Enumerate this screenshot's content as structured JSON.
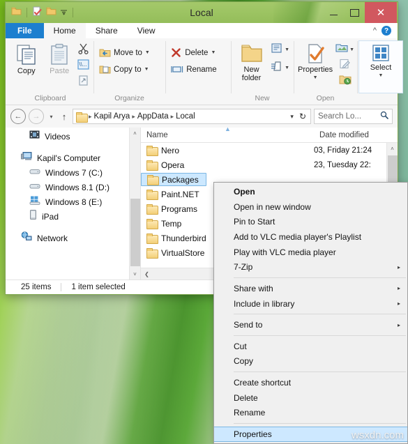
{
  "window": {
    "title": "Local",
    "quick_access": [
      "folder-icon",
      "properties-icon",
      "new-folder-icon",
      "qat-dropdown-icon"
    ],
    "controls": {
      "minimize": "–",
      "maximize": "□",
      "close": "✕"
    }
  },
  "tabs": [
    {
      "id": "file",
      "label": "File"
    },
    {
      "id": "home",
      "label": "Home"
    },
    {
      "id": "share",
      "label": "Share"
    },
    {
      "id": "view",
      "label": "View"
    }
  ],
  "ribbon": {
    "collapse_icon": "chevron-up-icon",
    "help_icon": "help-icon",
    "groups": [
      {
        "name": "Clipboard",
        "big_buttons": [
          {
            "label": "Copy",
            "dim": false
          },
          {
            "label": "Paste",
            "dim": true
          }
        ],
        "small_icons": [
          "cut-icon",
          "copy-path-icon",
          "paste-shortcut-icon"
        ]
      },
      {
        "name": "Organize",
        "items": [
          {
            "label": "Move to",
            "caret": true
          },
          {
            "label": "Copy to",
            "caret": true
          },
          {
            "label": "Delete",
            "caret": true
          },
          {
            "label": "Rename",
            "caret": false
          }
        ]
      },
      {
        "name": "New",
        "big_buttons": [
          {
            "label": "New folder",
            "dim": false
          }
        ],
        "small_icons": [
          "new-item-icon",
          "easy-access-icon"
        ]
      },
      {
        "name": "Open",
        "big_buttons": [
          {
            "label": "Properties",
            "dim": false,
            "caret": true
          }
        ],
        "small_icons": [
          "open-icon",
          "edit-icon",
          "history-icon"
        ]
      },
      {
        "name": "Select",
        "big_buttons": [
          {
            "label": "Select",
            "dim": false,
            "caret": true
          }
        ]
      }
    ]
  },
  "address_bar": {
    "back": "←",
    "forward": "→",
    "recent_caret": "▾",
    "up": "↑",
    "folder_icon": "folder-icon",
    "crumbs": [
      "Kapil Arya",
      "AppData",
      "Local"
    ],
    "crumb_sep": "▸",
    "dropdown": "▾",
    "refresh": "↻",
    "search_placeholder": "Search Lo...",
    "search_icon": "search-icon"
  },
  "nav_pane": {
    "items": [
      {
        "label": "Videos",
        "icon": "videos-icon",
        "indent": true
      },
      {
        "label": "Kapil's Computer",
        "icon": "computer-icon",
        "indent": false
      },
      {
        "label": "Windows 7 (C:)",
        "icon": "drive-icon",
        "indent": true
      },
      {
        "label": "Windows 8.1 (D:)",
        "icon": "drive-icon",
        "indent": true
      },
      {
        "label": "Windows 8 (E:)",
        "icon": "windows-drive-icon",
        "indent": true
      },
      {
        "label": "iPad",
        "icon": "device-icon",
        "indent": true
      },
      {
        "label": "Network",
        "icon": "network-icon",
        "indent": false
      }
    ],
    "scroll_up": "˄",
    "scroll_down": "˅"
  },
  "file_list": {
    "columns": [
      "Name",
      "Date modified"
    ],
    "rows": [
      {
        "name": "Nero",
        "date": "03, Friday 21:24",
        "selected": false
      },
      {
        "name": "Opera",
        "date": "23, Tuesday 22:",
        "selected": false
      },
      {
        "name": "Packages",
        "date": "",
        "selected": true
      },
      {
        "name": "Paint.NET",
        "date": "",
        "selected": false
      },
      {
        "name": "Programs",
        "date": "",
        "selected": false
      },
      {
        "name": "Temp",
        "date": "",
        "selected": false
      },
      {
        "name": "Thunderbird",
        "date": "",
        "selected": false
      },
      {
        "name": "VirtualStore",
        "date": "",
        "selected": false
      }
    ]
  },
  "status_bar": {
    "item_count": "25 items",
    "selection": "1 item selected"
  },
  "context_menu": {
    "items": [
      {
        "label": "Open",
        "bold": true,
        "submenu": false,
        "highlighted": false
      },
      {
        "label": "Open in new window",
        "bold": false,
        "submenu": false,
        "highlighted": false
      },
      {
        "label": "Pin to Start",
        "bold": false,
        "submenu": false,
        "highlighted": false
      },
      {
        "label": "Add to VLC media player's Playlist",
        "bold": false,
        "submenu": false,
        "highlighted": false
      },
      {
        "label": "Play with VLC media player",
        "bold": false,
        "submenu": false,
        "highlighted": false
      },
      {
        "label": "7-Zip",
        "bold": false,
        "submenu": true,
        "highlighted": false
      },
      {
        "separator": true
      },
      {
        "label": "Share with",
        "bold": false,
        "submenu": true,
        "highlighted": false
      },
      {
        "label": "Include in library",
        "bold": false,
        "submenu": true,
        "highlighted": false
      },
      {
        "separator": true
      },
      {
        "label": "Send to",
        "bold": false,
        "submenu": true,
        "highlighted": false
      },
      {
        "separator": true
      },
      {
        "label": "Cut",
        "bold": false,
        "submenu": false,
        "highlighted": false
      },
      {
        "label": "Copy",
        "bold": false,
        "submenu": false,
        "highlighted": false
      },
      {
        "separator": true
      },
      {
        "label": "Create shortcut",
        "bold": false,
        "submenu": false,
        "highlighted": false
      },
      {
        "label": "Delete",
        "bold": false,
        "submenu": false,
        "highlighted": false
      },
      {
        "label": "Rename",
        "bold": false,
        "submenu": false,
        "highlighted": false
      },
      {
        "separator": true
      },
      {
        "label": "Properties",
        "bold": false,
        "submenu": false,
        "highlighted": true
      }
    ],
    "submenu_arrow": "▸"
  },
  "watermark": "wsxdn.com",
  "colors": {
    "title_bar": "#9cc465",
    "file_tab": "#1d7fcf",
    "close_button": "#d1585f",
    "selection": "#cce8ff",
    "selection_border": "#7cb7e3",
    "menu_highlight": "#cde8ff",
    "folder_yellow": "#f3cf78"
  }
}
